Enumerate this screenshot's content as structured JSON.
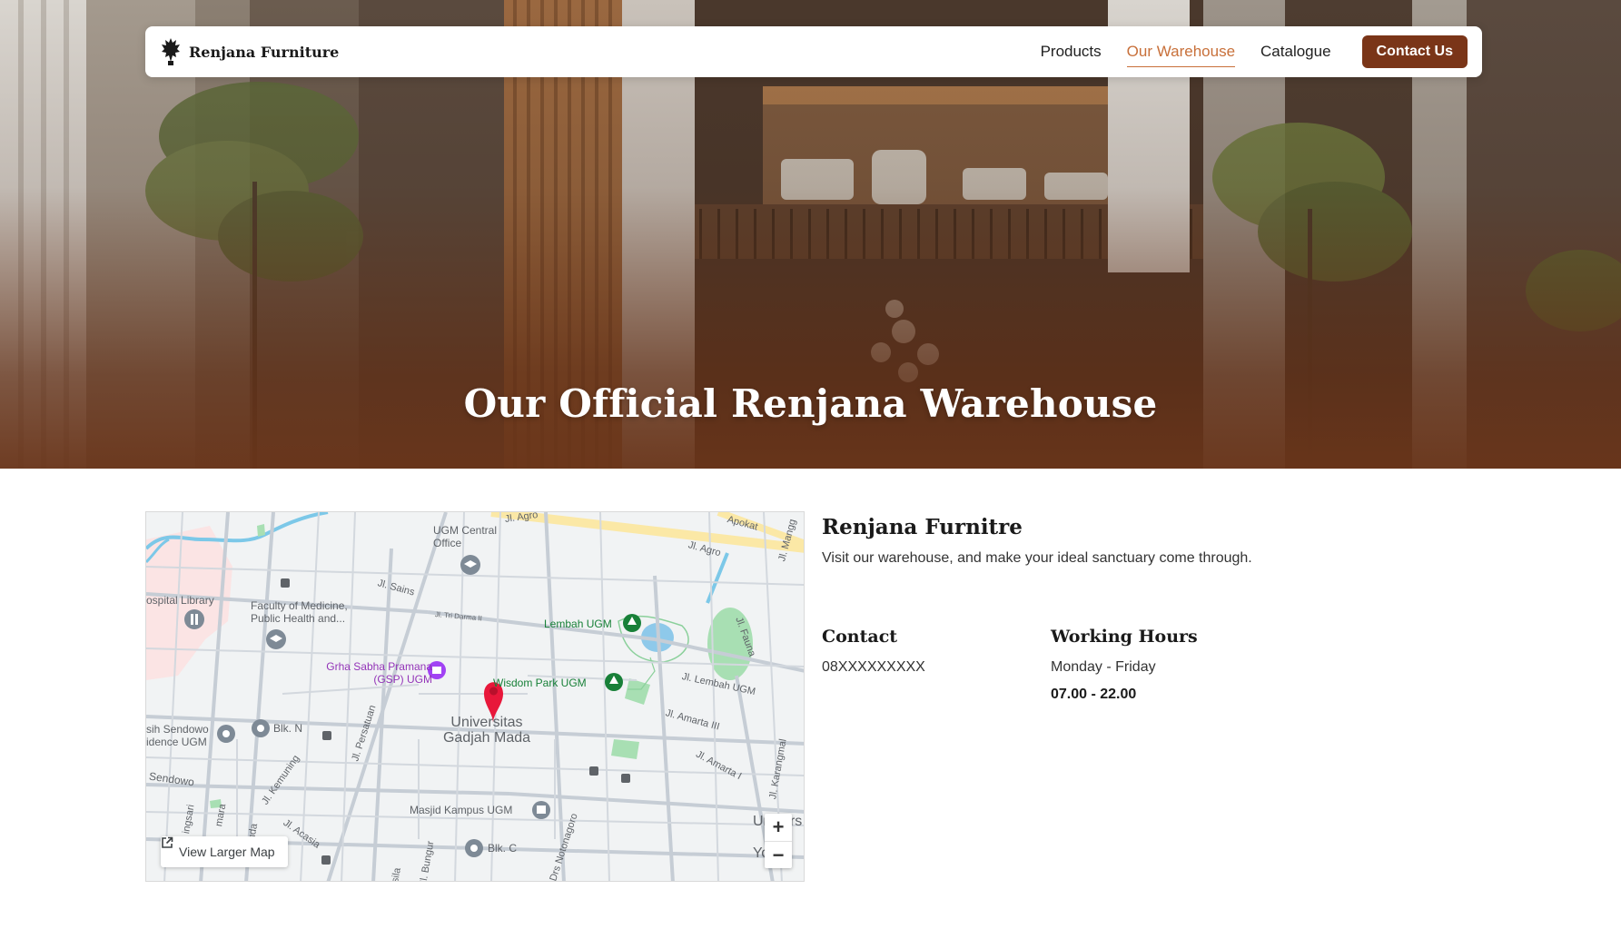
{
  "hero": {
    "title": "Our Official Renjana Warehouse"
  },
  "nav": {
    "brand_name": "Renjana Furniture",
    "links": [
      {
        "label": "Products",
        "active": false
      },
      {
        "label": "Our Warehouse",
        "active": true
      },
      {
        "label": "Catalogue",
        "active": false
      }
    ],
    "cta_label": "Contact Us",
    "colors": {
      "accent": "#c8703a",
      "button": "#7a3518"
    }
  },
  "map": {
    "labels": {
      "hospital_library": "ospital Library",
      "ugm_central_office": "UGM Central Office",
      "faculty_medicine": "Faculty of Medicine, Public Health and...",
      "grha_sabha": "Grha Sabha Pramana (GSP) UGM",
      "lembah_ugm": "Lembah UGM",
      "wisdom_park": "Wisdom Park UGM",
      "universitas": "Universitas Gadjah Mada",
      "sendowo_residence": "sih Sendowo idence UGM",
      "blk_n": "Blk. N",
      "blk_c": "Blk. C",
      "sendowo": "Sendowo",
      "masjid": "Masjid Kampus UGM",
      "jl_agro_1": "Jl. Agro",
      "jl_agro_2": "Jl. Agro",
      "apokat": "Apokat",
      "jl_mangga": "Jl. Mangg",
      "jl_sains": "Jl. Sains",
      "jl_tri_darma": "Jl. Tri Darma II",
      "jl_fauna": "Jl. Fauna",
      "jl_lembah_ugm": "Jl. Lembah UGM",
      "jl_amarta_3": "Jl. Amarta III",
      "jl_amarta_1": "Jl. Amarta I",
      "jl_karangmalang": "Jl. Karangmal",
      "jl_persatuan": "Jl. Persatuan",
      "jl_kemuning": "Jl. Kemuning",
      "jl_acasia": "Jl. Acasia",
      "jl_bungur": "Jl. Bungur",
      "drs_notonagoro": "Drs Notonagoro",
      "ingsari": "ingsari",
      "mara": "mara",
      "nda": "nda",
      "asila": "asila",
      "univ_partial": "Univers",
      "yog_partial": "Yog"
    },
    "view_larger": "View Larger Map",
    "zoom_in": "+",
    "zoom_out": "−"
  },
  "info": {
    "title": "Renjana Furnitre",
    "subtitle": "Visit our warehouse, and make your ideal sanctuary come through.",
    "contact": {
      "heading": "Contact",
      "value": "08XXXXXXXXX"
    },
    "hours": {
      "heading": "Working Hours",
      "days": "Monday - Friday",
      "time": "07.00 - 22.00"
    }
  }
}
